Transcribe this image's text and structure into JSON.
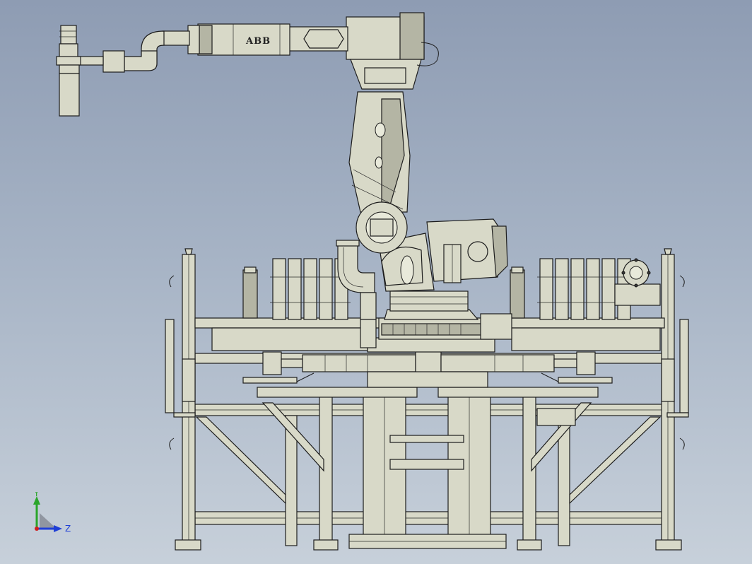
{
  "robot": {
    "brand_label": "ABB"
  },
  "triad": {
    "y_label": "Y",
    "z_label": "Z",
    "colors": {
      "y": "#2aa52a",
      "z": "#1f3fd6",
      "x": "#d02020"
    }
  }
}
